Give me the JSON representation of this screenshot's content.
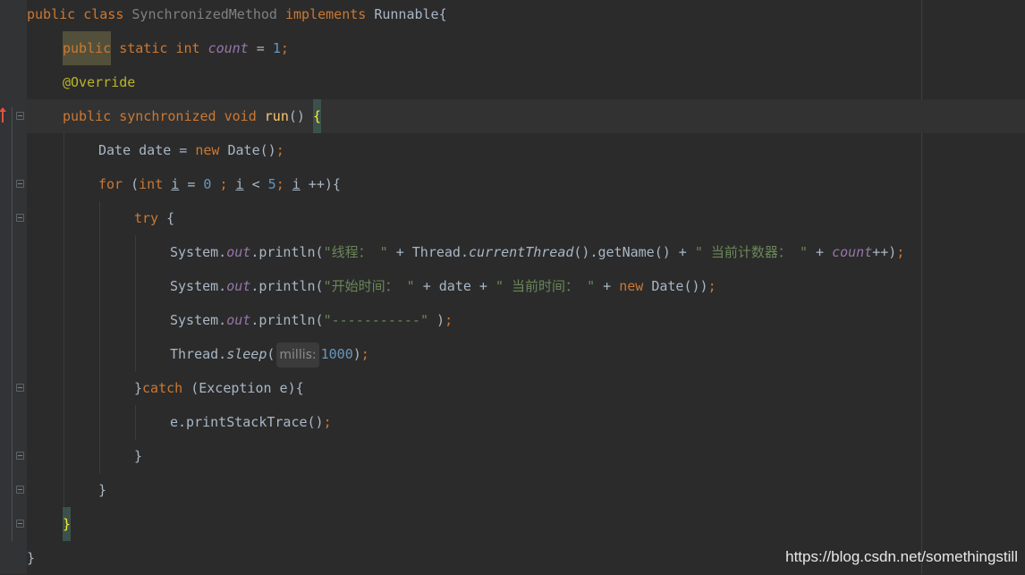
{
  "editor": {
    "language": "Java",
    "caret_line": 4
  },
  "code": {
    "l1": {
      "kw_public": "public",
      "kw_class": "class",
      "class_name": "SynchronizedMethod",
      "kw_implements": "implements",
      "iface": "Runnable",
      "brace": "{"
    },
    "l2": {
      "kw_public": "public",
      "kw_static": "static",
      "kw_int": "int",
      "field": "count",
      "assign": " = ",
      "value": "1",
      "semi": ";"
    },
    "l3": {
      "annotation": "@Override"
    },
    "l4": {
      "kw_public": "public",
      "kw_synchronized": "synchronized",
      "kw_void": "void",
      "method": "run",
      "parens": "() ",
      "brace": "{"
    },
    "l5": {
      "type": "Date date = ",
      "kw_new": "new",
      "ctor": " Date()",
      "semi": ";"
    },
    "l6": {
      "kw_for": "for",
      "open": " (",
      "kw_int": "int",
      "sp": " ",
      "var1": "i",
      "eq": " = ",
      "zero": "0",
      "semi1": " ;",
      "sp2": " ",
      "var2": "i",
      "lt": " < ",
      "five": "5",
      "semi2": ";",
      "sp3": " ",
      "var3": "i",
      "incr": " ++){"
    },
    "l7": {
      "kw_try": "try",
      "brace": " {"
    },
    "l8": {
      "sys": "System.",
      "out": "out",
      "println": ".println(",
      "str1": "\"线程： \"",
      "plus1": " + Thread.",
      "current": "currentThread",
      "getname": "().getName() + ",
      "str2": "\" 当前计数器： \"",
      "plus2": " + ",
      "count": "count",
      "tail": "++)",
      "semi": ";"
    },
    "l9": {
      "sys": "System.",
      "out": "out",
      "println": ".println(",
      "str1": "\"开始时间： \"",
      "mid": " + date + ",
      "str2": "\" 当前时间： \"",
      "plus": " + ",
      "kw_new": "new",
      "tail": " Date())",
      "semi": ";"
    },
    "l10": {
      "sys": "System.",
      "out": "out",
      "println": ".println(",
      "str": "\"-----------\"",
      "tail": " )",
      "semi": ";"
    },
    "l11": {
      "thread": "Thread.",
      "sleep": "sleep",
      "open": "(",
      "hint": "millis:",
      "num": "1000",
      "close": ")",
      "semi": ";"
    },
    "l12": {
      "close": "}",
      "kw_catch": "catch",
      "rest": " (Exception e){"
    },
    "l13": {
      "stmt": "e.printStackTrace()",
      "semi": ";"
    },
    "l14": {
      "brace": "}"
    },
    "l15": {
      "brace": "}"
    },
    "l16": {
      "brace": "}"
    },
    "l17": {
      "brace": "}"
    }
  },
  "watermark": "https://blog.csdn.net/somethingstill"
}
